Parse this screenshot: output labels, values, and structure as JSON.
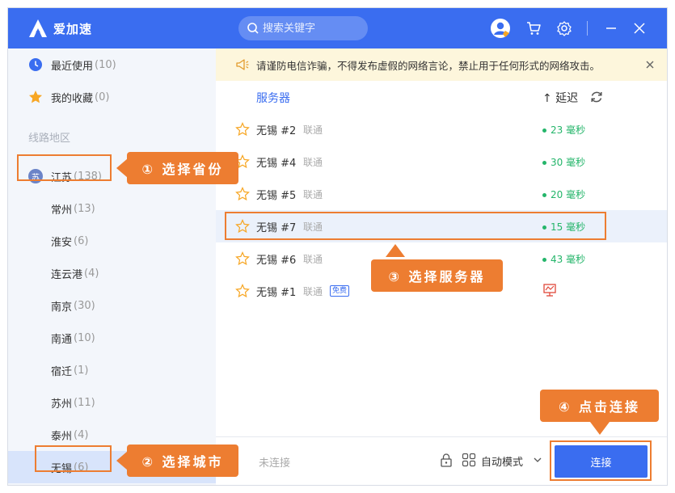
{
  "app": {
    "title": "爱加速"
  },
  "search": {
    "placeholder": "搜索关键字"
  },
  "sidebar": {
    "recent": {
      "label": "最近使用",
      "count": "(10)"
    },
    "favorites": {
      "label": "我的收藏",
      "count": "(0)"
    },
    "section": "线路地区",
    "province": {
      "badge": "苏",
      "label": "江苏",
      "count": "(138)"
    },
    "cities": [
      {
        "label": "常州",
        "count": "(13)"
      },
      {
        "label": "淮安",
        "count": "(6)"
      },
      {
        "label": "连云港",
        "count": "(4)"
      },
      {
        "label": "南京",
        "count": "(30)"
      },
      {
        "label": "南通",
        "count": "(10)"
      },
      {
        "label": "宿迁",
        "count": "(1)"
      },
      {
        "label": "苏州",
        "count": "(11)"
      },
      {
        "label": "泰州",
        "count": "(4)"
      },
      {
        "label": "无锡",
        "count": "(6)"
      }
    ]
  },
  "notice": {
    "text": "请谨防电信诈骗，不得发布虚假的网络言论，禁止用于任何形式的网络攻击。"
  },
  "list": {
    "header_server": "服务器",
    "header_latency": "↑ 延迟",
    "rows": [
      {
        "name": "无锡 #2",
        "isp": "联通",
        "latency": "23 毫秒"
      },
      {
        "name": "无锡 #4",
        "isp": "联通",
        "latency": "30 毫秒"
      },
      {
        "name": "无锡 #5",
        "isp": "联通",
        "latency": "20 毫秒"
      },
      {
        "name": "无锡 #7",
        "isp": "联通",
        "latency": "15 毫秒"
      },
      {
        "name": "无锡 #6",
        "isp": "联通",
        "latency": "43 毫秒"
      },
      {
        "name": "无锡 #1",
        "isp": "联通",
        "badge": "免费",
        "latency": ""
      }
    ]
  },
  "bottom": {
    "status": "未连接",
    "mode": "自动模式",
    "connect_label": "连接"
  },
  "annotations": {
    "step1": "① 选择省份",
    "step2": "② 选择城市",
    "step3": "③ 选择服务器",
    "step4": "④ 点击连接"
  },
  "colors": {
    "brand": "#3a6df0",
    "accent": "#ed7d31",
    "latency_good": "#24b56a"
  }
}
